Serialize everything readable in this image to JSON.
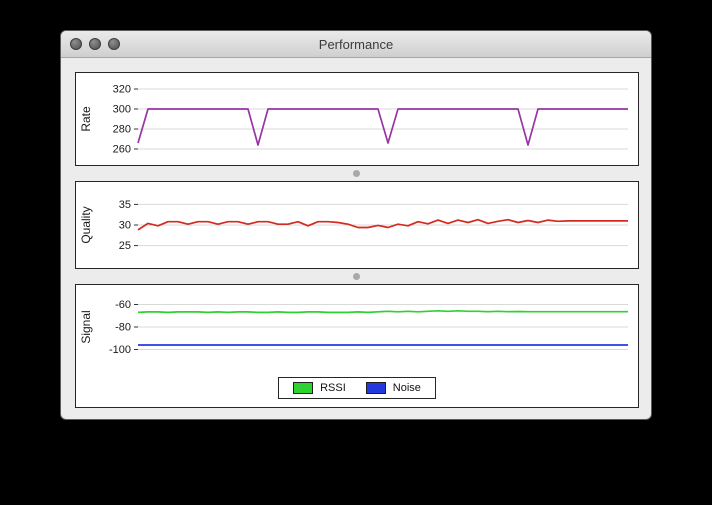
{
  "window": {
    "title": "Performance",
    "buttons": [
      "close",
      "minimize",
      "zoom"
    ]
  },
  "legend": {
    "items": [
      {
        "label": "RSSI",
        "color": "#2fd32f"
      },
      {
        "label": "Noise",
        "color": "#2438e0"
      }
    ]
  },
  "chart_data": [
    {
      "id": "rate",
      "type": "line",
      "ylabel": "Rate",
      "yticks": [
        260,
        280,
        300,
        320
      ],
      "ylim": [
        250,
        330
      ],
      "grid": true,
      "series": [
        {
          "name": "Rate",
          "color": "#9933a6",
          "values": [
            266,
            300,
            300,
            300,
            300,
            300,
            300,
            300,
            300,
            300,
            300,
            300,
            264,
            300,
            300,
            300,
            300,
            300,
            300,
            300,
            300,
            300,
            300,
            300,
            300,
            266,
            300,
            300,
            300,
            300,
            300,
            300,
            300,
            300,
            300,
            300,
            300,
            300,
            300,
            264,
            300,
            300,
            300,
            300,
            300,
            300,
            300,
            300,
            300,
            300
          ]
        }
      ]
    },
    {
      "id": "quality",
      "type": "line",
      "ylabel": "Quality",
      "yticks": [
        25,
        30,
        35
      ],
      "ylim": [
        21,
        39
      ],
      "grid": true,
      "series": [
        {
          "name": "Quality",
          "color": "#d42a20",
          "values": [
            28.8,
            30.4,
            29.8,
            30.8,
            30.8,
            30.2,
            30.8,
            30.8,
            30.2,
            30.8,
            30.8,
            30.2,
            30.8,
            30.8,
            30.2,
            30.2,
            30.8,
            29.8,
            30.8,
            30.8,
            30.6,
            30.2,
            29.4,
            29.4,
            29.9,
            29.4,
            30.2,
            29.8,
            30.8,
            30.3,
            31.2,
            30.4,
            31.2,
            30.6,
            31.3,
            30.4,
            30.9,
            31.3,
            30.6,
            31.1,
            30.6,
            31.2,
            30.9,
            31.0,
            31.0,
            31.0,
            31.0,
            31.0,
            31.0,
            31.0
          ]
        }
      ]
    },
    {
      "id": "signal",
      "type": "line",
      "ylabel": "Signal",
      "yticks": [
        -100,
        -80,
        -60
      ],
      "ylim": [
        -112,
        -48
      ],
      "grid": true,
      "series": [
        {
          "name": "RSSI",
          "color": "#2fd32f",
          "values": [
            -67.0,
            -66.6,
            -66.6,
            -67.0,
            -66.6,
            -66.6,
            -66.6,
            -67.0,
            -66.6,
            -67.0,
            -66.6,
            -66.6,
            -67.0,
            -67.0,
            -66.6,
            -67.0,
            -67.0,
            -66.6,
            -66.6,
            -67.0,
            -67.0,
            -67.0,
            -66.6,
            -67.0,
            -66.5,
            -66.0,
            -66.5,
            -66.0,
            -66.5,
            -66.0,
            -65.6,
            -66.0,
            -65.6,
            -66.0,
            -66.0,
            -66.4,
            -66.0,
            -66.4,
            -66.2,
            -66.4,
            -66.4,
            -66.4,
            -66.4,
            -66.4,
            -66.4,
            -66.4,
            -66.4,
            -66.4,
            -66.4,
            -66.4
          ]
        },
        {
          "name": "Noise",
          "color": "#2438e0",
          "values": [
            -96,
            -96
          ]
        }
      ]
    }
  ]
}
